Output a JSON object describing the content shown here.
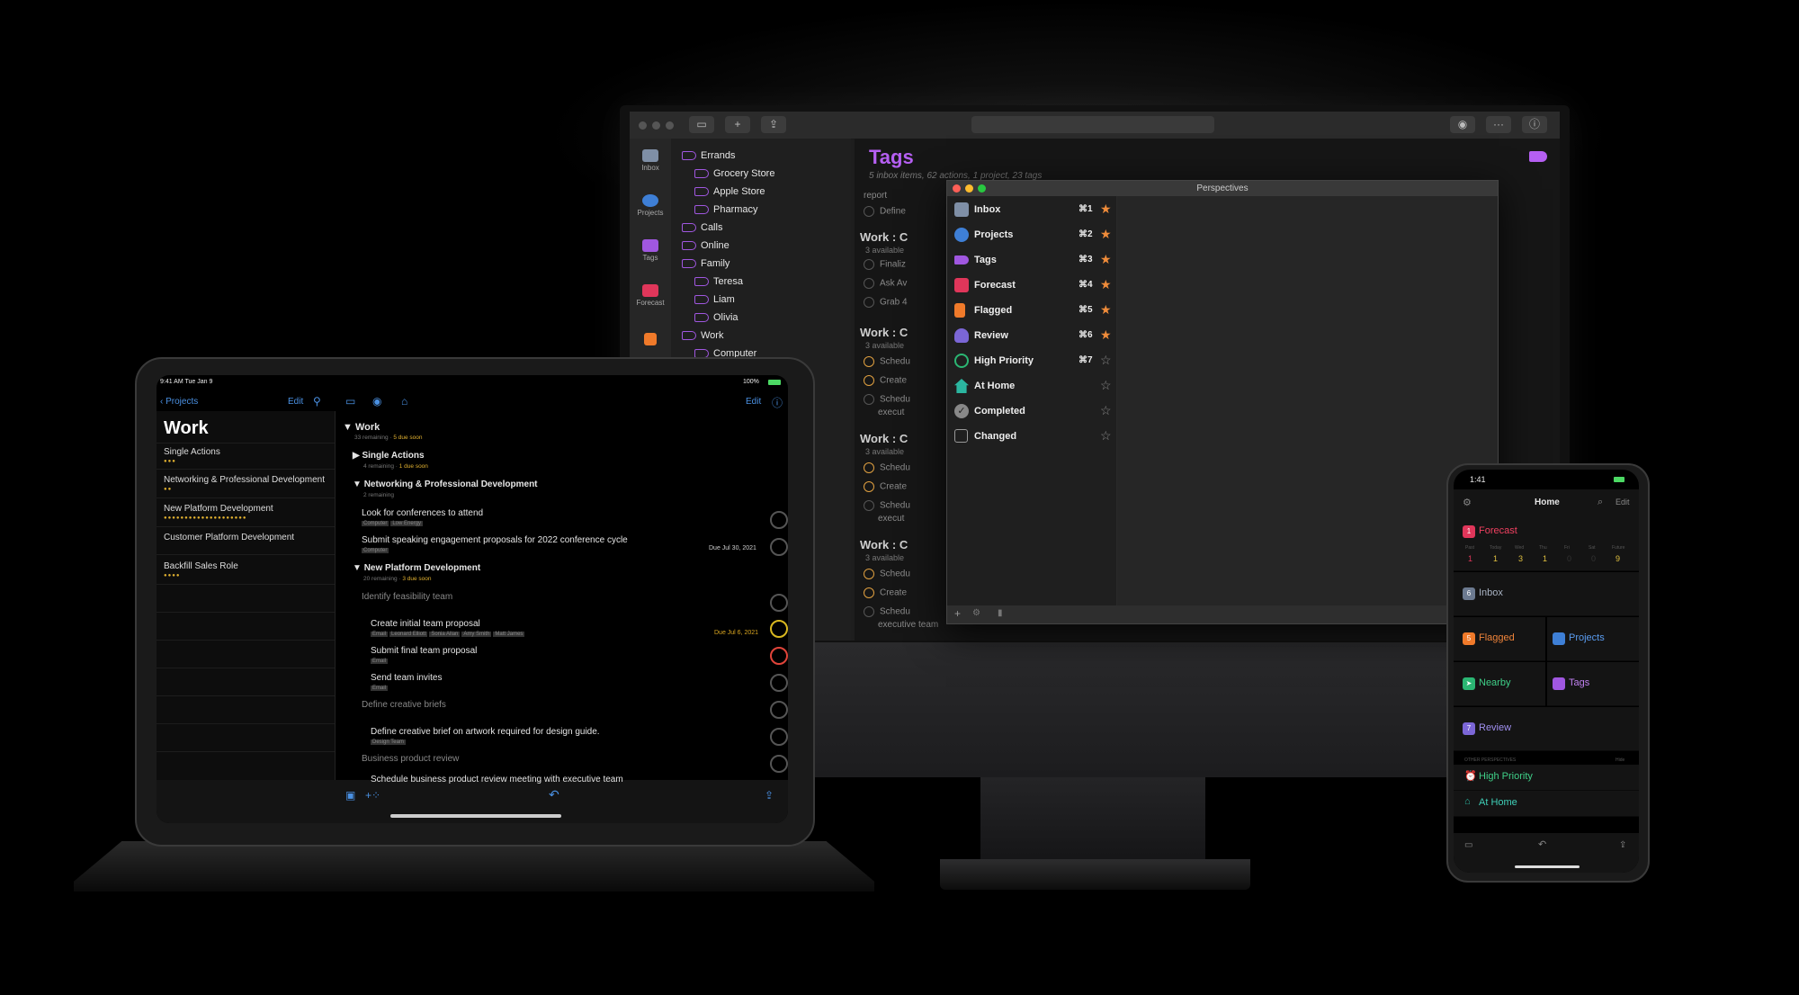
{
  "mac": {
    "tags_title": "Tags",
    "tags_subtitle": "5 inbox items, 62 actions, 1 project, 23 tags",
    "tags": [
      {
        "label": "Errands"
      },
      {
        "label": "Grocery Store"
      },
      {
        "label": "Apple Store"
      },
      {
        "label": "Pharmacy"
      },
      {
        "label": "Calls"
      },
      {
        "label": "Online"
      },
      {
        "label": "Family"
      },
      {
        "label": "Teresa"
      },
      {
        "label": "Liam"
      },
      {
        "label": "Olivia"
      },
      {
        "label": "Work"
      },
      {
        "label": "Computer"
      }
    ],
    "sidebar": [
      {
        "label": "Inbox"
      },
      {
        "label": "Projects"
      },
      {
        "label": "Tags"
      },
      {
        "label": "Forecast"
      }
    ],
    "groups": [
      {
        "title": "Work : C",
        "sub": "3 available"
      },
      {
        "title": "Work : C",
        "sub": "3 available"
      },
      {
        "title": "Work : C",
        "sub": "3 available"
      },
      {
        "title": "Work : C",
        "sub": "3 available"
      }
    ],
    "rows": [
      {
        "label": "report"
      },
      {
        "label": "Define"
      },
      {
        "label": "Finaliz"
      },
      {
        "label": "Ask Av"
      },
      {
        "label": "Grab 4"
      },
      {
        "label": "Schedu"
      },
      {
        "label": "Create"
      },
      {
        "label": "Schedu"
      },
      {
        "label": "execut"
      },
      {
        "label": "Schedu"
      },
      {
        "label": "Create"
      },
      {
        "label": "Schedu"
      },
      {
        "label": "execut"
      },
      {
        "label": "Schedu"
      },
      {
        "label": "Create"
      },
      {
        "label": "Schedu"
      },
      {
        "label": "executive team"
      }
    ]
  },
  "perspectives": {
    "window_title": "Perspectives",
    "items": [
      {
        "label": "Inbox",
        "shortcut": "⌘1",
        "starred": true,
        "color": "#7f8fa6"
      },
      {
        "label": "Projects",
        "shortcut": "⌘2",
        "starred": true,
        "color": "#3e7fd6"
      },
      {
        "label": "Tags",
        "shortcut": "⌘3",
        "starred": true,
        "color": "#a057e0"
      },
      {
        "label": "Forecast",
        "shortcut": "⌘4",
        "starred": true,
        "color": "#e0365a"
      },
      {
        "label": "Flagged",
        "shortcut": "⌘5",
        "starred": true,
        "color": "#f07a2a"
      },
      {
        "label": "Review",
        "shortcut": "⌘6",
        "starred": true,
        "color": "#7b66d6"
      },
      {
        "label": "High Priority",
        "shortcut": "⌘7",
        "starred": false,
        "color": "#2bb673"
      },
      {
        "label": "At Home",
        "shortcut": "",
        "starred": false,
        "color": "#2bb6a0"
      },
      {
        "label": "Completed",
        "shortcut": "",
        "starred": false,
        "color": "#888888"
      },
      {
        "label": "Changed",
        "shortcut": "",
        "starred": false,
        "color": "#888888"
      }
    ]
  },
  "ipad": {
    "status_time": "9:41 AM  Tue Jan 9",
    "status_battery": "100%",
    "back_label": "Projects",
    "edit_left": "Edit",
    "edit_right": "Edit",
    "folder_title": "Work",
    "projects": [
      {
        "label": "Single Actions",
        "dots": "●●●"
      },
      {
        "label": "Networking & Professional Development",
        "dots": "●●"
      },
      {
        "label": "New Platform Development",
        "dots": "●●●●●●●●●●●●●●●●●●●●"
      },
      {
        "label": "Customer Platform Development",
        "dots": ""
      },
      {
        "label": "Backfill Sales Role",
        "dots": "●●●●"
      }
    ],
    "outline": {
      "work_title": "Work",
      "work_meta": "33 remaining",
      "work_due": "5 due soon",
      "single_title": "Single Actions",
      "single_meta": "4 remaining",
      "single_due": "1 due soon",
      "net_title": "Networking & Professional Development",
      "net_meta": "2 remaining",
      "look_title": "Look for conferences to attend",
      "look_tags": [
        "Computer",
        "Low Energy"
      ],
      "submit_title": "Submit speaking engagement proposals for 2022 conference cycle",
      "submit_tags": [
        "Computer"
      ],
      "submit_due": "Due Jul 30, 2021",
      "npd_title": "New Platform Development",
      "npd_meta": "20 remaining",
      "npd_due": "3 due soon",
      "feas_title": "Identify feasibility team",
      "initial_title": "Create initial team proposal",
      "initial_tags": [
        "Email",
        "Leonard Elliott",
        "Sonia Allan",
        "Amy Smith",
        "Matt James"
      ],
      "initial_due": "Due Jul 6, 2021",
      "final_title": "Submit final team proposal",
      "final_tags": [
        "Email"
      ],
      "invites_title": "Send team invites",
      "invites_tags": [
        "Email"
      ],
      "briefs_title": "Define creative briefs",
      "brief_title": "Define creative brief on artwork required for design guide.",
      "brief_tags": [
        "Design Team"
      ],
      "review_title": "Business product review",
      "sched_title": "Schedule business product review meeting with executive team"
    }
  },
  "iphone": {
    "time": "1:41",
    "home_title": "Home",
    "edit": "Edit",
    "forecast": {
      "label": "Forecast",
      "count": "1",
      "days": [
        "Past",
        "Today",
        "Wed",
        "Thu",
        "Fri",
        "Sat",
        "Future"
      ],
      "values": [
        "1",
        "1",
        "3",
        "1",
        "0",
        "0",
        "9"
      ]
    },
    "inbox": {
      "label": "Inbox",
      "count": "6"
    },
    "flagged": {
      "label": "Flagged",
      "count": "5"
    },
    "projects": {
      "label": "Projects"
    },
    "nearby": {
      "label": "Nearby"
    },
    "tags": {
      "label": "Tags"
    },
    "review": {
      "label": "Review",
      "count": "7"
    },
    "other_header": "OTHER PERSPECTIVES",
    "other_hide": "Hide",
    "high_priority": "High Priority",
    "at_home": "At Home"
  },
  "colors": {
    "accent_purple": "#b55ff2",
    "star_orange": "#f08c3a",
    "link_blue": "#4a90e2"
  }
}
